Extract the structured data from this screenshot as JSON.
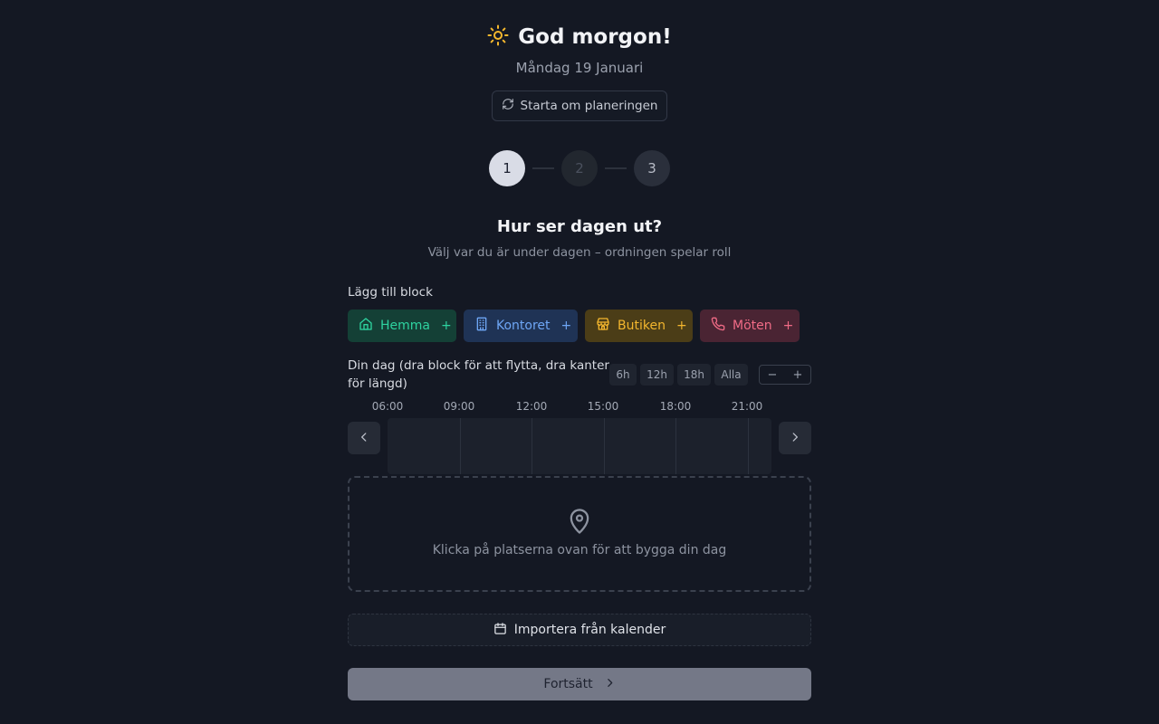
{
  "header": {
    "greeting": "God morgon!",
    "greeting_icon": "sun-icon",
    "date": "Måndag 19 Januari",
    "restart_label": "Starta om planeringen"
  },
  "stepper": {
    "steps": [
      "1",
      "2",
      "3"
    ],
    "current": 1
  },
  "section": {
    "title": "Hur ser dagen ut?",
    "subtitle": "Välj var du är under dagen – ordningen spelar roll"
  },
  "blocks": {
    "label": "Lägg till block",
    "items": [
      {
        "label": "Hemma",
        "icon": "home-icon",
        "color": "#2ed3a0"
      },
      {
        "label": "Kontoret",
        "icon": "building-icon",
        "color": "#6ea6f5"
      },
      {
        "label": "Butiken",
        "icon": "store-icon",
        "color": "#f3b62e"
      },
      {
        "label": "Möten",
        "icon": "phone-icon",
        "color": "#f06b86"
      }
    ],
    "plus": "+"
  },
  "timeline": {
    "label": "Din dag (dra block för att flytta, dra kanter för längd)",
    "zoom_options": [
      "6h",
      "12h",
      "18h",
      "Alla"
    ],
    "zoom_out": "−",
    "zoom_in": "+",
    "ticks": [
      "06:00",
      "09:00",
      "12:00",
      "15:00",
      "18:00",
      "21:00"
    ]
  },
  "drop_zone": {
    "text": "Klicka på platserna ovan för att bygga din dag",
    "icon": "map-pin-icon"
  },
  "actions": {
    "import_label": "Importera från kalender",
    "continue_label": "Fortsätt"
  }
}
